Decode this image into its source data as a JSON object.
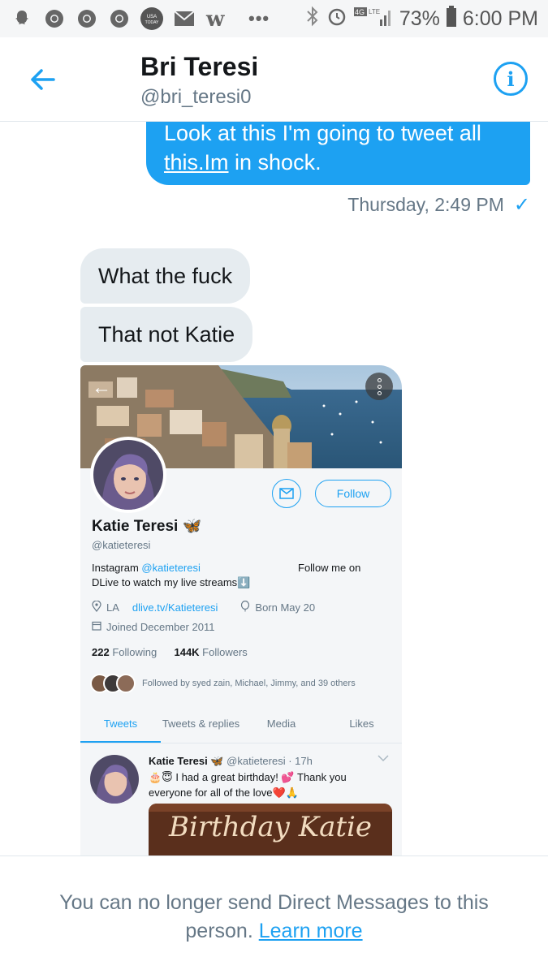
{
  "status_bar": {
    "left_icons": [
      "snapchat-icon",
      "chrome-icon",
      "chrome-icon",
      "chrome-icon",
      "usa-today-icon",
      "mail-icon",
      "w-app-icon"
    ],
    "usa_today_label": "USA TODAY",
    "overflow": "•••",
    "network": "4G LTE",
    "battery": "73%",
    "time": "6:00 PM"
  },
  "header": {
    "name": "Bri Teresi",
    "handle": "@bri_teresi0",
    "info_label": "i"
  },
  "messages": {
    "sent": {
      "line1": "Look at this I'm going to tweet all",
      "link_text": "this.Im",
      "rest": " in shock."
    },
    "timestamp": "Thursday, 2:49 PM",
    "check": "✓",
    "received": [
      "What the fuck",
      "That not Katie"
    ]
  },
  "screenshot": {
    "profile_name": "Katie Teresi 🦋",
    "profile_handle": "@katieteresi",
    "follow_label": "Follow",
    "bio_prefix": "Instagram ",
    "bio_link": "@katieteresi",
    "bio_right": "Follow me on",
    "bio_line2": "DLive to watch my live streams⬇️",
    "location": "LA",
    "website": "dlive.tv/Katieteresi",
    "born": "Born May 20",
    "joined": "Joined December 2011",
    "following_count": "222",
    "following_label": " Following",
    "followers_count": "144K",
    "followers_label": " Followers",
    "followed_by": "Followed by syed zain, Michael, Jimmy, and 39 others",
    "tabs": [
      "Tweets",
      "Tweets & replies",
      "Media",
      "Likes"
    ],
    "tweet_name": "Katie Teresi 🦋",
    "tweet_meta": " @katieteresi · 17h",
    "tweet_text": "🎂😇 I had a great birthday! 💕 Thank you everyone for all of the love❤️🙏",
    "cake_text": "Birthday Katie"
  },
  "footer": {
    "text": "You can no longer send Direct Messages to this person. ",
    "link": "Learn more"
  },
  "colors": {
    "accent": "#1da1f2",
    "bubble_received": "#e6ecf0",
    "muted_text": "#657786"
  }
}
